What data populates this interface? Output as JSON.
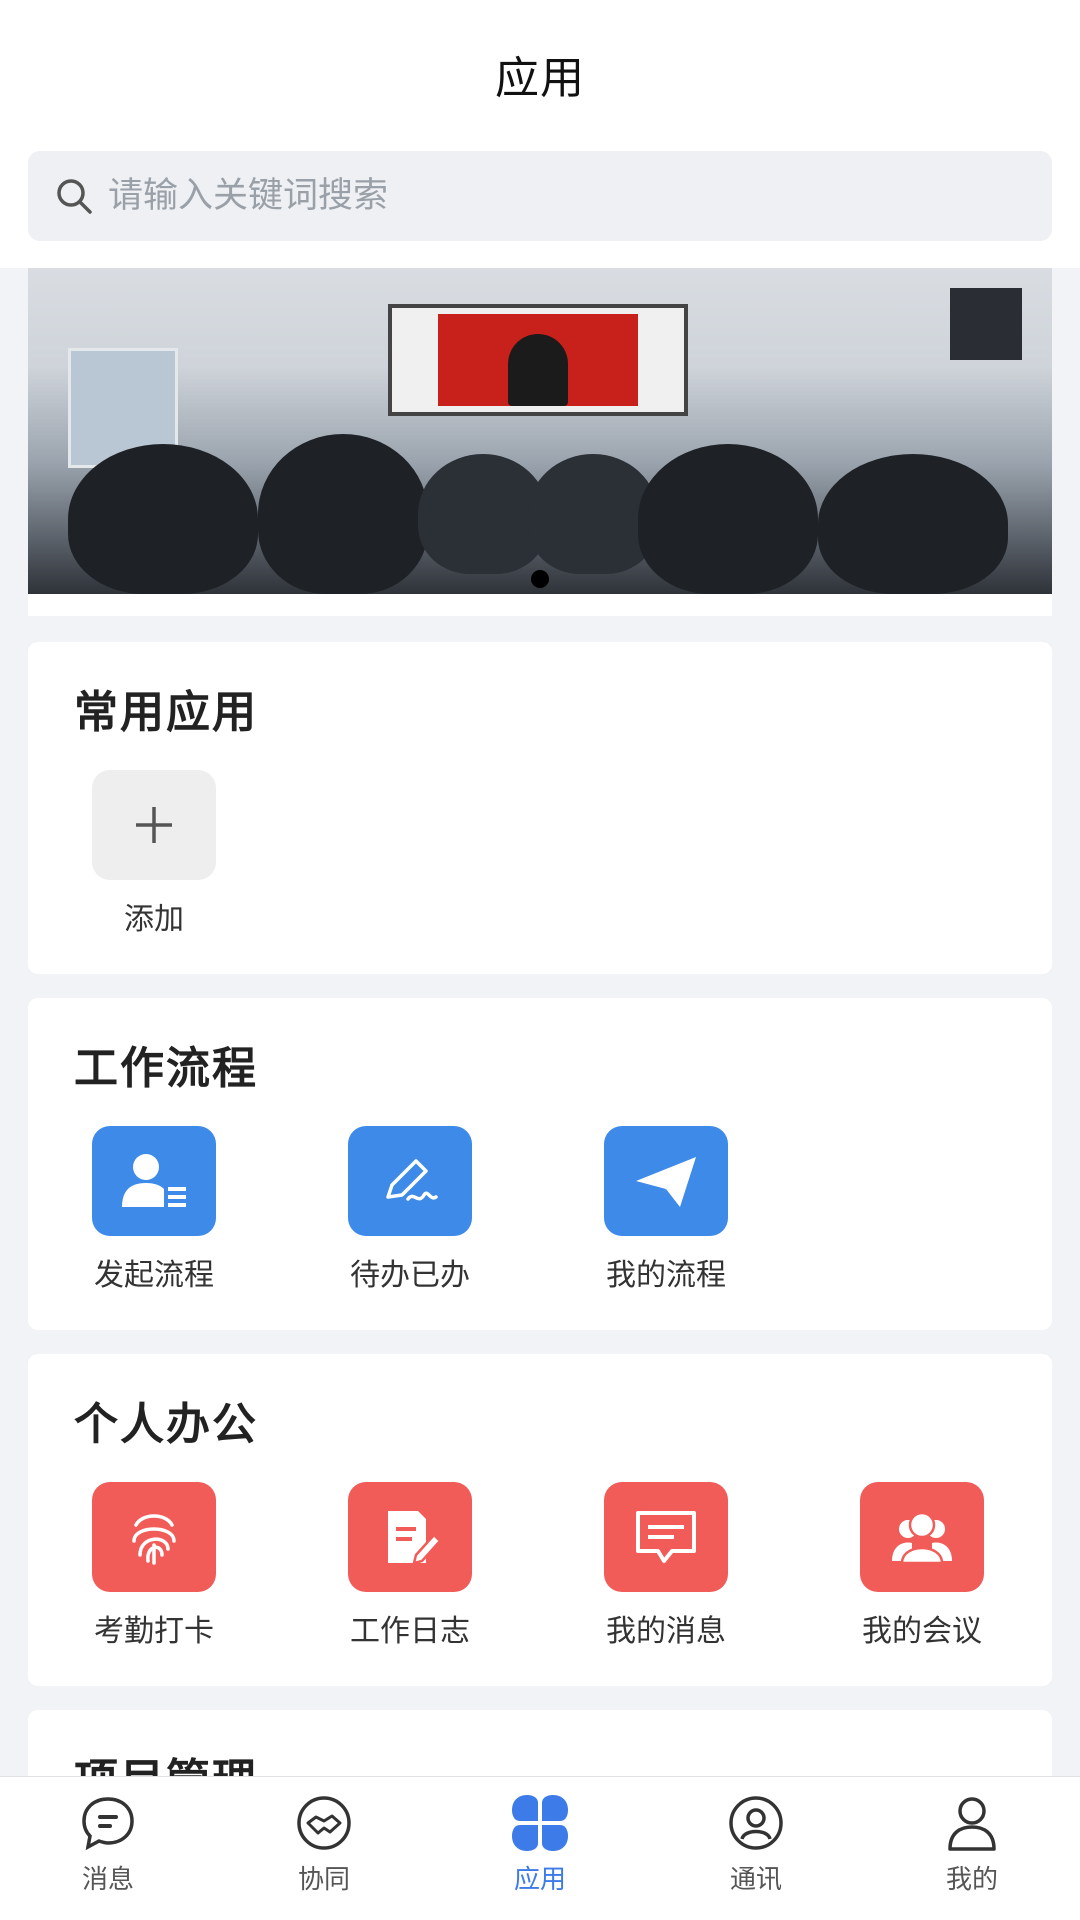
{
  "header": {
    "title": "应用"
  },
  "search": {
    "placeholder": "请输入关键词搜索"
  },
  "banner": {
    "slide_count": 1,
    "active_slide": 1
  },
  "sections": {
    "common": {
      "title": "常用应用",
      "items": [
        {
          "label": "添加",
          "icon": "plus-icon"
        }
      ]
    },
    "workflow": {
      "title": "工作流程",
      "items": [
        {
          "label": "发起流程",
          "icon": "user-list-icon"
        },
        {
          "label": "待办已办",
          "icon": "pen-signature-icon"
        },
        {
          "label": "我的流程",
          "icon": "paper-plane-icon"
        }
      ]
    },
    "personal": {
      "title": "个人办公",
      "items": [
        {
          "label": "考勤打卡",
          "icon": "fingerprint-icon"
        },
        {
          "label": "工作日志",
          "icon": "document-edit-icon"
        },
        {
          "label": "我的消息",
          "icon": "message-icon"
        },
        {
          "label": "我的会议",
          "icon": "meeting-users-icon"
        }
      ]
    },
    "project": {
      "title": "项目管理"
    }
  },
  "tabbar": {
    "active": "应用",
    "items": [
      {
        "label": "消息",
        "icon": "chat-bubble-icon"
      },
      {
        "label": "协同",
        "icon": "handshake-icon"
      },
      {
        "label": "应用",
        "icon": "apps-grid-icon"
      },
      {
        "label": "通讯",
        "icon": "contacts-icon"
      },
      {
        "label": "我的",
        "icon": "person-icon"
      }
    ]
  },
  "colors": {
    "accent": "#3d7be8",
    "workflow_icon_bg": "#3d8ae8",
    "personal_icon_bg": "#f25c58",
    "page_bg": "#f2f3f6"
  }
}
